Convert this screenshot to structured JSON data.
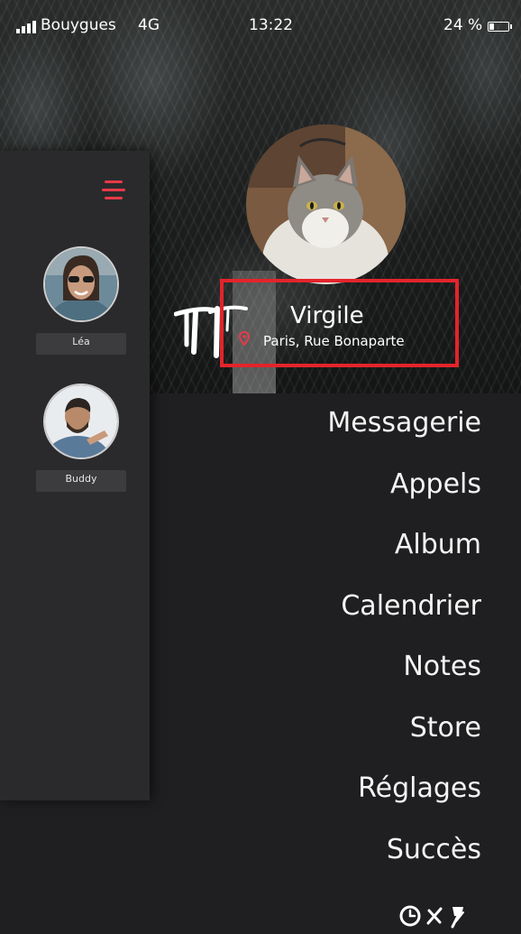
{
  "status_bar": {
    "carrier": "Bouygues",
    "network": "4G",
    "time": "13:22",
    "battery": "24 %",
    "battery_level": 0.24
  },
  "profile": {
    "name": "Virgile",
    "location": "Paris, Rue Bonaparte",
    "avatar_icon": "cat-photo"
  },
  "drawer": {
    "menu_icon": "hamburger-icon",
    "contacts": [
      {
        "name": "Léa"
      },
      {
        "name": "Buddy"
      }
    ]
  },
  "menu": {
    "items": [
      {
        "label": "Messagerie"
      },
      {
        "label": "Appels"
      },
      {
        "label": "Album"
      },
      {
        "label": "Calendrier"
      },
      {
        "label": "Notes"
      },
      {
        "label": "Store"
      },
      {
        "label": "Réglages"
      },
      {
        "label": "Succès"
      }
    ]
  },
  "bottom_icons": [
    "clock-icon",
    "sword-icon",
    "pin-icon"
  ],
  "colors": {
    "accent": "#e83a48",
    "highlight": "#e3242b",
    "background": "#1f1f21",
    "drawer": "#2a2a2c",
    "text": "#f4f4f4"
  }
}
